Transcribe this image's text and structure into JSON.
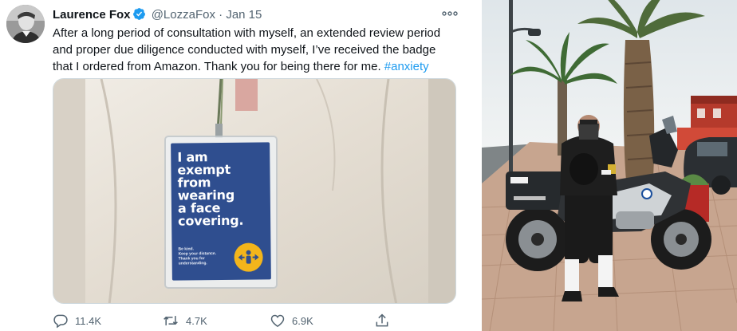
{
  "tweet": {
    "author_name": "Laurence Fox",
    "handle": "@LozzaFox",
    "separator": "·",
    "date": "Jan 15",
    "text_lines": [
      "After a long period of consultation with myself, an extended review period",
      "and proper due diligence conducted with myself, I’ve received the badge",
      "that I ordered from Amazon. Thank you for being there for me."
    ],
    "hashtag": "#anxiety",
    "badge": {
      "title": "I am\nexempt\nfrom\nwearing\na face\ncovering.",
      "small_text": "Be kind.\nKeep your distance.\nThank you for\nunderstanding."
    },
    "counts": {
      "replies": "11.4K",
      "retweets": "4.7K",
      "likes": "6.9K"
    }
  },
  "photo_panel": {
    "icons": [
      "gs-sticker",
      "bmw-roundel"
    ]
  },
  "colors": {
    "link_blue": "#1d9bf0",
    "verified_blue": "#1d9bf0",
    "muted_text": "#536471",
    "badge_blue": "#2f4e8f",
    "badge_yellow": "#f3b51b"
  }
}
